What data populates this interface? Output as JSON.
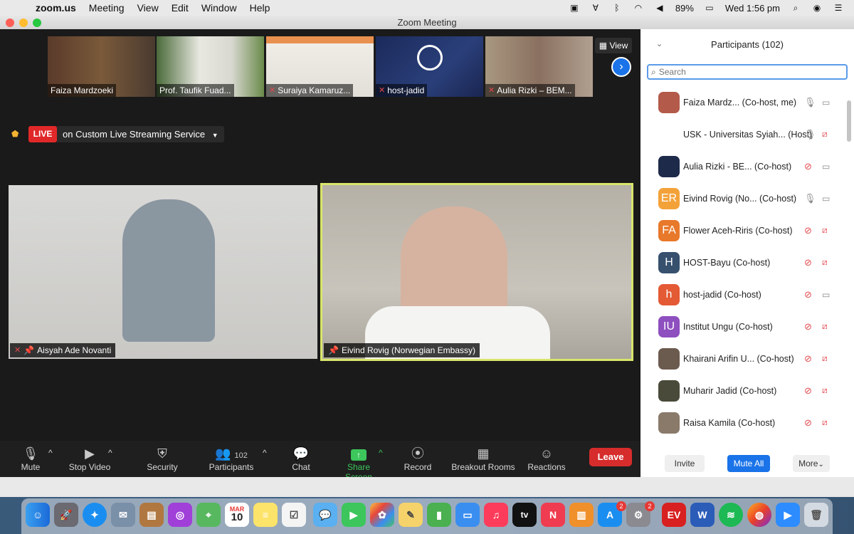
{
  "menubar": {
    "app": "zoom.us",
    "items": [
      "Meeting",
      "View",
      "Edit",
      "Window",
      "Help"
    ],
    "battery": "89%",
    "clock": "Wed 1:56 pm"
  },
  "window": {
    "title": "Zoom Meeting"
  },
  "thumbnails": [
    {
      "label": "Faiza Mardzoeki",
      "muted": false
    },
    {
      "label": "Prof. Taufik Fuad...",
      "muted": false
    },
    {
      "label": "Suraiya Kamaruz...",
      "muted": true
    },
    {
      "label": "host-jadid",
      "muted": true
    },
    {
      "label": "Aulia Rizki – BEM...",
      "muted": true
    }
  ],
  "view_button": "View",
  "live": {
    "badge": "LIVE",
    "text": "on Custom Live Streaming Service"
  },
  "tiles": {
    "left_name": "Aisyah Ade Novanti",
    "right_name": "Eivind Rovig (Norwegian Embassy)"
  },
  "toolbar": {
    "mute": "Mute",
    "stop_video": "Stop Video",
    "security": "Security",
    "participants": "Participants",
    "participants_count": "102",
    "chat": "Chat",
    "share_screen": "Share Screen",
    "record": "Record",
    "breakout_rooms": "Breakout Rooms",
    "reactions": "Reactions",
    "leave": "Leave"
  },
  "panel": {
    "title": "Participants (102)",
    "search_placeholder": "Search",
    "participants": [
      {
        "name": "Faiza Mardz...  (Co-host, me)",
        "initials": "",
        "color": "#b35a4a",
        "mic_off": false,
        "cam_off": false
      },
      {
        "name": "USK - Universitas Syiah...  (Host)",
        "initials": "",
        "color": "#ffffff",
        "mic_off": false,
        "cam_off": true
      },
      {
        "name": "Aulia Rizki - BE...  (Co-host)",
        "initials": "",
        "color": "#1e2a4a",
        "mic_off": true,
        "cam_off": false
      },
      {
        "name": "Eivind Rovig (No...  (Co-host)",
        "initials": "ER",
        "color": "#f3a23a",
        "mic_off": false,
        "cam_off": false
      },
      {
        "name": "Flower Aceh-Riris (Co-host)",
        "initials": "FA",
        "color": "#e8782a",
        "mic_off": true,
        "cam_off": true
      },
      {
        "name": "HOST-Bayu (Co-host)",
        "initials": "H",
        "color": "#37506e",
        "mic_off": true,
        "cam_off": true
      },
      {
        "name": "host-jadid (Co-host)",
        "initials": "h",
        "color": "#e35a35",
        "mic_off": true,
        "cam_off": false
      },
      {
        "name": "Institut Ungu (Co-host)",
        "initials": "IU",
        "color": "#8e4fbf",
        "mic_off": true,
        "cam_off": true
      },
      {
        "name": "Khairani Arifin U...  (Co-host)",
        "initials": "",
        "color": "#6b5a4e",
        "mic_off": true,
        "cam_off": true
      },
      {
        "name": "Muharir Jadid (Co-host)",
        "initials": "",
        "color": "#4a4a3a",
        "mic_off": true,
        "cam_off": true
      },
      {
        "name": "Raisa Kamila (Co-host)",
        "initials": "",
        "color": "#8a7a6a",
        "mic_off": true,
        "cam_off": true
      }
    ],
    "invite": "Invite",
    "mute_all": "Mute All",
    "more": "More"
  },
  "dock": {
    "calendar_month": "MAR",
    "calendar_day": "10",
    "appletv_label": "tv",
    "badges": {
      "appstore": "2",
      "settings": "2"
    }
  }
}
